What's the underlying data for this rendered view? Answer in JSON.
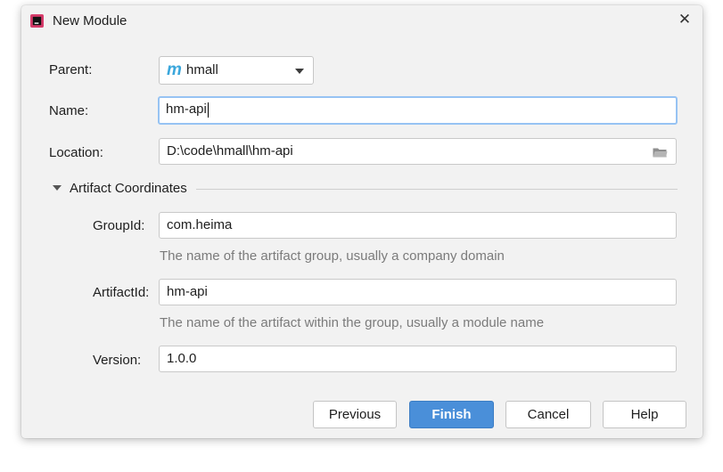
{
  "window": {
    "title": "New Module",
    "close_glyph": "✕"
  },
  "form": {
    "parent": {
      "label": "Parent:",
      "icon_text": "m",
      "value": "hmall"
    },
    "name": {
      "label": "Name:",
      "value": "hm-api"
    },
    "location": {
      "label": "Location:",
      "value": "D:\\code\\hmall\\hm-api"
    }
  },
  "artifact": {
    "section_label": "Artifact Coordinates",
    "group_id": {
      "label": "GroupId:",
      "value": "com.heima",
      "hint": "The name of the artifact group, usually a company domain"
    },
    "artifact_id": {
      "label": "ArtifactId:",
      "value": "hm-api",
      "hint": "The name of the artifact within the group, usually a module name"
    },
    "version": {
      "label": "Version:",
      "value": "1.0.0"
    }
  },
  "buttons": {
    "previous": "Previous",
    "finish": "Finish",
    "cancel": "Cancel",
    "help": "Help"
  },
  "colors": {
    "accent": "#4a8fd9",
    "focus_ring": "#97c3f3",
    "maven_logo": "#3ba7dc"
  }
}
